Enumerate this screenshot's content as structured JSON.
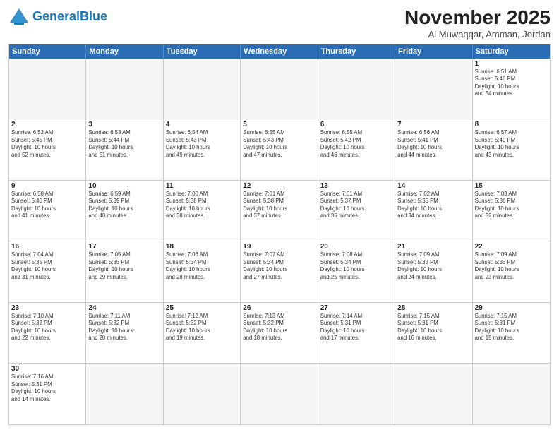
{
  "header": {
    "logo_general": "General",
    "logo_blue": "Blue",
    "month": "November 2025",
    "location": "Al Muwaqqar, Amman, Jordan"
  },
  "weekdays": [
    "Sunday",
    "Monday",
    "Tuesday",
    "Wednesday",
    "Thursday",
    "Friday",
    "Saturday"
  ],
  "rows": [
    [
      {
        "day": "",
        "info": "",
        "empty": true
      },
      {
        "day": "",
        "info": "",
        "empty": true
      },
      {
        "day": "",
        "info": "",
        "empty": true
      },
      {
        "day": "",
        "info": "",
        "empty": true
      },
      {
        "day": "",
        "info": "",
        "empty": true
      },
      {
        "day": "",
        "info": "",
        "empty": true
      },
      {
        "day": "1",
        "info": "Sunrise: 6:51 AM\nSunset: 5:46 PM\nDaylight: 10 hours\nand 54 minutes.",
        "empty": false
      }
    ],
    [
      {
        "day": "2",
        "info": "Sunrise: 6:52 AM\nSunset: 5:45 PM\nDaylight: 10 hours\nand 52 minutes.",
        "empty": false
      },
      {
        "day": "3",
        "info": "Sunrise: 6:53 AM\nSunset: 5:44 PM\nDaylight: 10 hours\nand 51 minutes.",
        "empty": false
      },
      {
        "day": "4",
        "info": "Sunrise: 6:54 AM\nSunset: 5:43 PM\nDaylight: 10 hours\nand 49 minutes.",
        "empty": false
      },
      {
        "day": "5",
        "info": "Sunrise: 6:55 AM\nSunset: 5:43 PM\nDaylight: 10 hours\nand 47 minutes.",
        "empty": false
      },
      {
        "day": "6",
        "info": "Sunrise: 6:55 AM\nSunset: 5:42 PM\nDaylight: 10 hours\nand 46 minutes.",
        "empty": false
      },
      {
        "day": "7",
        "info": "Sunrise: 6:56 AM\nSunset: 5:41 PM\nDaylight: 10 hours\nand 44 minutes.",
        "empty": false
      },
      {
        "day": "8",
        "info": "Sunrise: 6:57 AM\nSunset: 5:40 PM\nDaylight: 10 hours\nand 43 minutes.",
        "empty": false
      }
    ],
    [
      {
        "day": "9",
        "info": "Sunrise: 6:58 AM\nSunset: 5:40 PM\nDaylight: 10 hours\nand 41 minutes.",
        "empty": false
      },
      {
        "day": "10",
        "info": "Sunrise: 6:59 AM\nSunset: 5:39 PM\nDaylight: 10 hours\nand 40 minutes.",
        "empty": false
      },
      {
        "day": "11",
        "info": "Sunrise: 7:00 AM\nSunset: 5:38 PM\nDaylight: 10 hours\nand 38 minutes.",
        "empty": false
      },
      {
        "day": "12",
        "info": "Sunrise: 7:01 AM\nSunset: 5:38 PM\nDaylight: 10 hours\nand 37 minutes.",
        "empty": false
      },
      {
        "day": "13",
        "info": "Sunrise: 7:01 AM\nSunset: 5:37 PM\nDaylight: 10 hours\nand 35 minutes.",
        "empty": false
      },
      {
        "day": "14",
        "info": "Sunrise: 7:02 AM\nSunset: 5:36 PM\nDaylight: 10 hours\nand 34 minutes.",
        "empty": false
      },
      {
        "day": "15",
        "info": "Sunrise: 7:03 AM\nSunset: 5:36 PM\nDaylight: 10 hours\nand 32 minutes.",
        "empty": false
      }
    ],
    [
      {
        "day": "16",
        "info": "Sunrise: 7:04 AM\nSunset: 5:35 PM\nDaylight: 10 hours\nand 31 minutes.",
        "empty": false
      },
      {
        "day": "17",
        "info": "Sunrise: 7:05 AM\nSunset: 5:35 PM\nDaylight: 10 hours\nand 29 minutes.",
        "empty": false
      },
      {
        "day": "18",
        "info": "Sunrise: 7:06 AM\nSunset: 5:34 PM\nDaylight: 10 hours\nand 28 minutes.",
        "empty": false
      },
      {
        "day": "19",
        "info": "Sunrise: 7:07 AM\nSunset: 5:34 PM\nDaylight: 10 hours\nand 27 minutes.",
        "empty": false
      },
      {
        "day": "20",
        "info": "Sunrise: 7:08 AM\nSunset: 5:34 PM\nDaylight: 10 hours\nand 25 minutes.",
        "empty": false
      },
      {
        "day": "21",
        "info": "Sunrise: 7:09 AM\nSunset: 5:33 PM\nDaylight: 10 hours\nand 24 minutes.",
        "empty": false
      },
      {
        "day": "22",
        "info": "Sunrise: 7:09 AM\nSunset: 5:33 PM\nDaylight: 10 hours\nand 23 minutes.",
        "empty": false
      }
    ],
    [
      {
        "day": "23",
        "info": "Sunrise: 7:10 AM\nSunset: 5:32 PM\nDaylight: 10 hours\nand 22 minutes.",
        "empty": false
      },
      {
        "day": "24",
        "info": "Sunrise: 7:11 AM\nSunset: 5:32 PM\nDaylight: 10 hours\nand 20 minutes.",
        "empty": false
      },
      {
        "day": "25",
        "info": "Sunrise: 7:12 AM\nSunset: 5:32 PM\nDaylight: 10 hours\nand 19 minutes.",
        "empty": false
      },
      {
        "day": "26",
        "info": "Sunrise: 7:13 AM\nSunset: 5:32 PM\nDaylight: 10 hours\nand 18 minutes.",
        "empty": false
      },
      {
        "day": "27",
        "info": "Sunrise: 7:14 AM\nSunset: 5:31 PM\nDaylight: 10 hours\nand 17 minutes.",
        "empty": false
      },
      {
        "day": "28",
        "info": "Sunrise: 7:15 AM\nSunset: 5:31 PM\nDaylight: 10 hours\nand 16 minutes.",
        "empty": false
      },
      {
        "day": "29",
        "info": "Sunrise: 7:15 AM\nSunset: 5:31 PM\nDaylight: 10 hours\nand 15 minutes.",
        "empty": false
      }
    ],
    [
      {
        "day": "30",
        "info": "Sunrise: 7:16 AM\nSunset: 5:31 PM\nDaylight: 10 hours\nand 14 minutes.",
        "empty": false
      },
      {
        "day": "",
        "info": "",
        "empty": true
      },
      {
        "day": "",
        "info": "",
        "empty": true
      },
      {
        "day": "",
        "info": "",
        "empty": true
      },
      {
        "day": "",
        "info": "",
        "empty": true
      },
      {
        "day": "",
        "info": "",
        "empty": true
      },
      {
        "day": "",
        "info": "",
        "empty": true
      }
    ]
  ]
}
